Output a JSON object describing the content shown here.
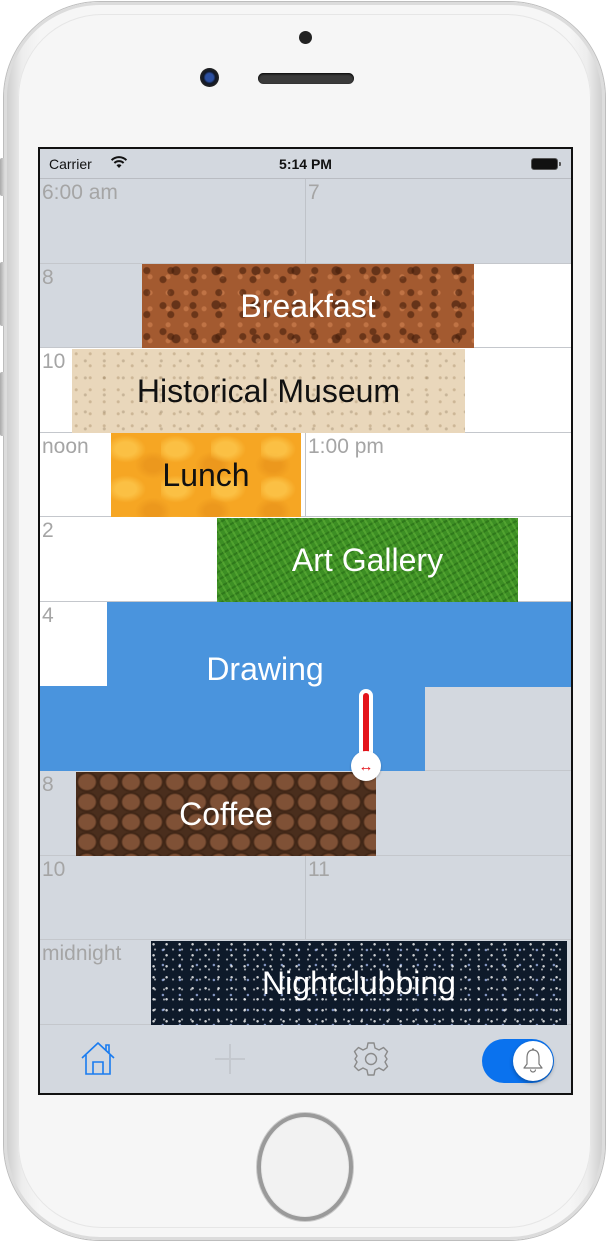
{
  "status_bar": {
    "carrier": "Carrier",
    "time": "5:14 PM",
    "wifi_icon": "wifi-icon",
    "battery_icon": "battery-full-icon"
  },
  "schedule": {
    "hour_labels": {
      "h6": "6:00 am",
      "h7": "7",
      "h8": "8",
      "h10": "10",
      "h12": "noon",
      "h13": "1:00 pm",
      "h14": "2",
      "h16": "4",
      "h20": "8",
      "h22": "10",
      "h23": "11",
      "h0": "midnight"
    },
    "events": [
      {
        "title": "Breakfast",
        "texture": "bread",
        "text_color": "light"
      },
      {
        "title": "Historical Museum",
        "texture": "paper",
        "text_color": "dark"
      },
      {
        "title": "Lunch",
        "texture": "orange",
        "text_color": "dark"
      },
      {
        "title": "Art Gallery",
        "texture": "grass",
        "text_color": "light"
      },
      {
        "title": "Drawing",
        "texture": "solid-blue",
        "text_color": "light",
        "selected": true
      },
      {
        "title": "Coffee",
        "texture": "coffee-beans",
        "text_color": "light"
      },
      {
        "title": "Nightclubbing",
        "texture": "starry-sky",
        "text_color": "light"
      }
    ],
    "resize_handle_icon": "resize-horizontal-icon"
  },
  "toolbar": {
    "home_icon": "home-icon",
    "add_icon": "plus-icon",
    "settings_icon": "gear-icon",
    "notifications_toggle": {
      "icon": "bell-icon",
      "on": true
    }
  },
  "colors": {
    "accent": "#0a72ee",
    "selected_event": "#4a94dd",
    "grid_gray": "#d3d8df",
    "handle_red": "#e4141b",
    "hour_label": "#a5a5a5"
  }
}
